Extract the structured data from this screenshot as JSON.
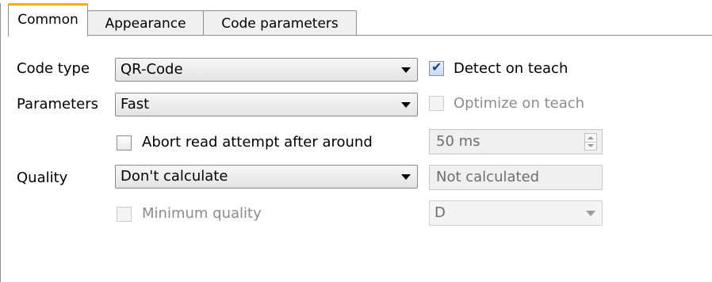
{
  "tabs": [
    {
      "label": "Common",
      "active": true
    },
    {
      "label": "Appearance",
      "active": false
    },
    {
      "label": "Code parameters",
      "active": false
    }
  ],
  "form": {
    "code_type": {
      "label": "Code type",
      "value": "QR-Code"
    },
    "detect_on_teach": {
      "label": "Detect on teach",
      "checked": true
    },
    "parameters": {
      "label": "Parameters",
      "value": "Fast"
    },
    "optimize_on_teach": {
      "label": "Optimize on teach",
      "checked": false,
      "enabled": false
    },
    "abort_read": {
      "label": "Abort read attempt after around",
      "checked": false
    },
    "abort_timeout": {
      "value": "50 ms",
      "enabled": false
    },
    "quality": {
      "label": "Quality",
      "value": "Don't calculate"
    },
    "quality_result": {
      "value": "Not calculated",
      "enabled": false
    },
    "minimum_quality": {
      "label": "Minimum quality",
      "checked": false,
      "enabled": false
    },
    "minimum_quality_grade": {
      "value": "D",
      "enabled": false
    }
  },
  "icons": {
    "checkmark": "✔"
  },
  "colors": {
    "active_tab_accent": "#f2b200",
    "disabled_text": "#8c8c8c"
  }
}
